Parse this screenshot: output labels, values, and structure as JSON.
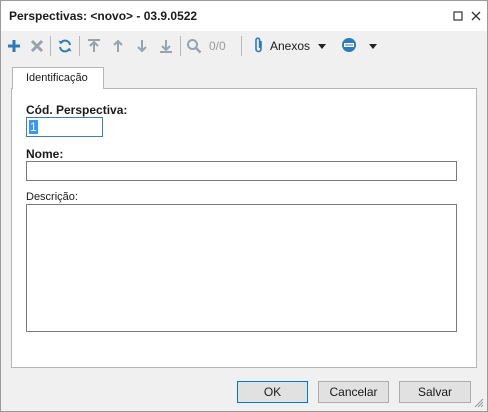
{
  "window": {
    "title": "Perspectivas: <novo> - 03.9.0522"
  },
  "toolbar": {
    "icons": [
      "add-icon",
      "delete-icon",
      "refresh-icon",
      "first-record-icon",
      "previous-record-icon",
      "next-record-icon",
      "last-record-icon",
      "search-icon",
      "paperclip-icon",
      "database-icon"
    ],
    "counter": "0/0",
    "anexos_label": "Anexos"
  },
  "tabs": [
    {
      "label": "Identificação",
      "active": true
    }
  ],
  "form": {
    "code_label": "Cód. Perspectiva:",
    "code_value": "1",
    "name_label": "Nome:",
    "name_value": "",
    "description_label": "Descrição:",
    "description_value": ""
  },
  "buttons": {
    "ok": "OK",
    "cancel": "Cancelar",
    "save": "Salvar"
  },
  "colors": {
    "accent": "#2b7bb9",
    "selection": "#3399ff",
    "focus_border": "#3c7fb1"
  }
}
